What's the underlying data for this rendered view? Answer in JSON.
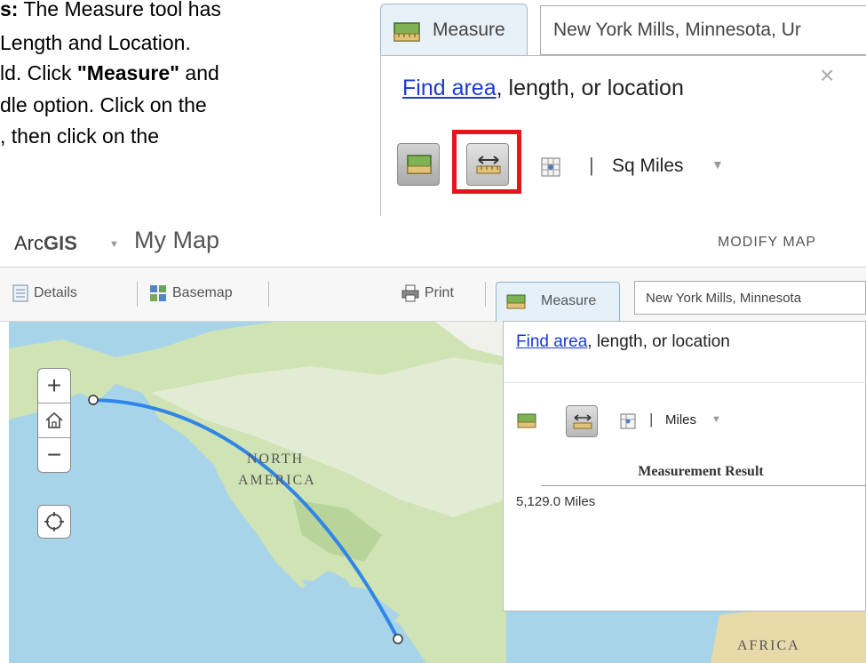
{
  "instructions": {
    "line1_bold": "s:",
    "line1": " The Measure tool has",
    "line2": "Length and Location.",
    "line3_a": "ld. Click ",
    "line3_bold": "\"Measure\"",
    "line3_b": " and",
    "line4": "dle option.  Click on the",
    "line5": ", then click on the"
  },
  "zoom_callout": {
    "tab_label": "Measure",
    "search_value": "New York Mills, Minnesota, Ur",
    "close_glyph": "×",
    "heading_link": "Find area",
    "heading_rest": ", length, or location",
    "separator": "|",
    "unit": "Sq Miles",
    "caret": "▼"
  },
  "header": {
    "brand_prefix": "Arc",
    "brand_bold": "GIS",
    "brand_caret": "▼",
    "map_title": "My Map",
    "modify_map": "MODIFY MAP"
  },
  "toolbar": {
    "details": "Details",
    "basemap": "Basemap",
    "print": "Print",
    "measure": "Measure",
    "search_value": "New York Mills, Minnesota"
  },
  "map": {
    "label_north": "NORTH",
    "label_america": "AMERICA",
    "label_africa": "AFRICA",
    "zoom_in": "+",
    "zoom_out": "−"
  },
  "measure_panel": {
    "heading_link": "Find area",
    "heading_rest": ", length, or location",
    "separator": "|",
    "unit": "Miles",
    "caret": "▼",
    "result_title": "Measurement Result",
    "result_value": "5,129.0 Miles"
  },
  "colors": {
    "measure_line": "#2f86e8",
    "highlight_box": "#e8141b",
    "link": "#1b3bd1",
    "water": "#a8d4ea",
    "land": "#cfe3b4"
  }
}
